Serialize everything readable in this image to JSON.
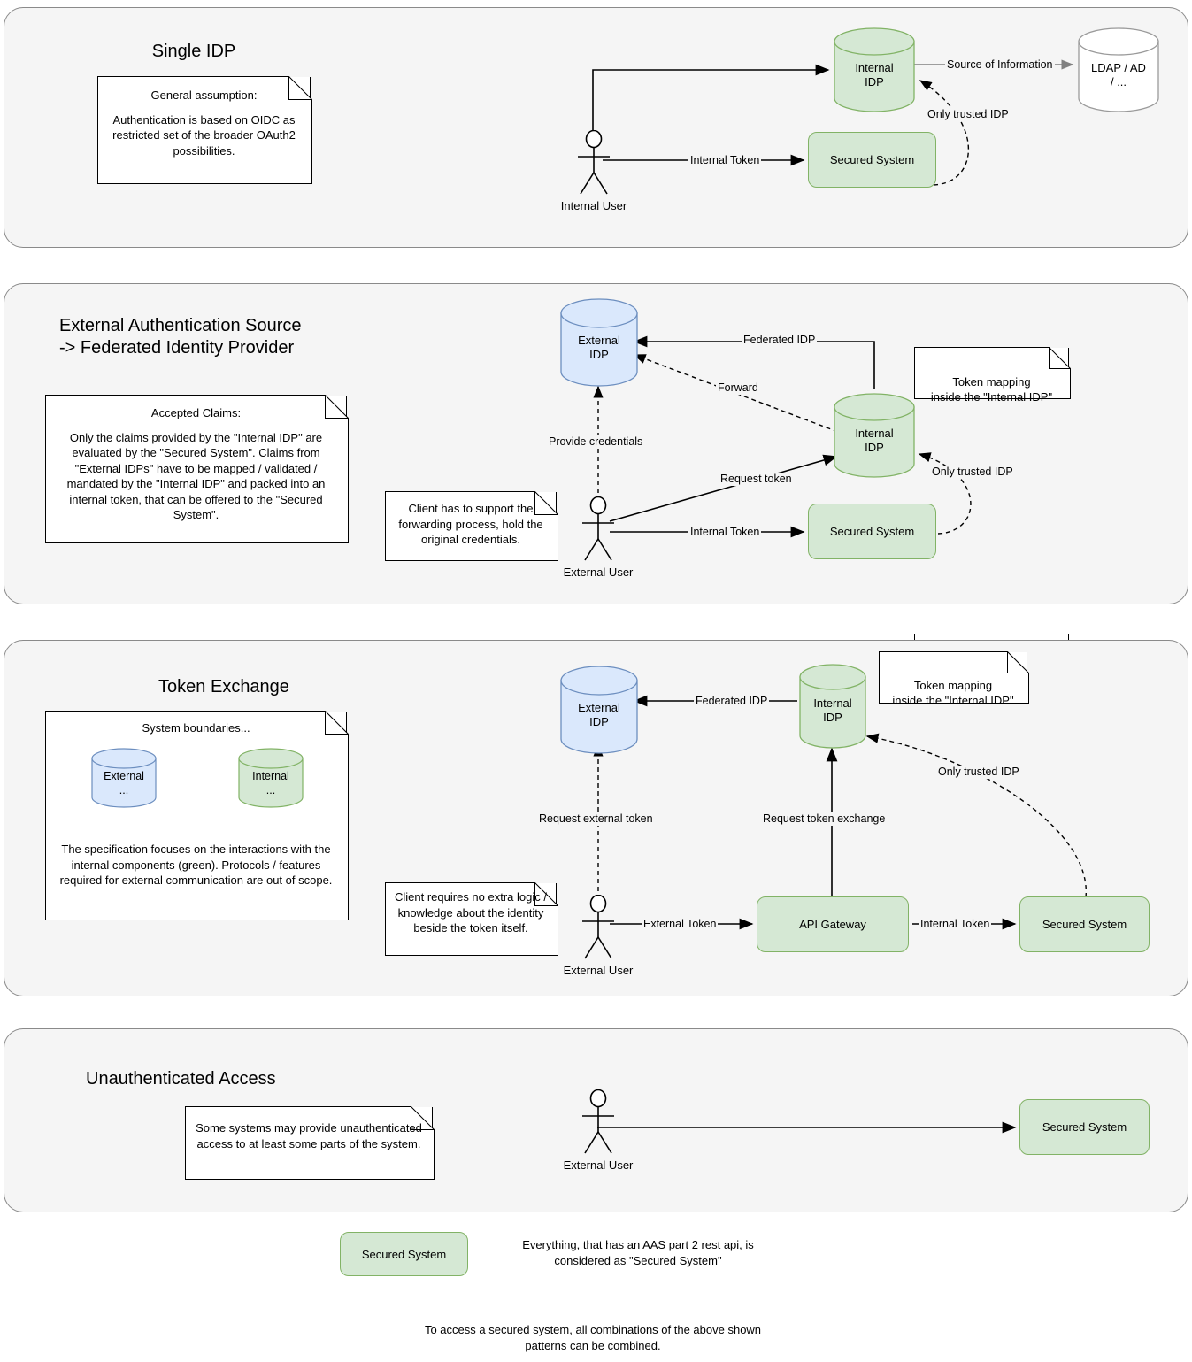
{
  "diagram": {
    "title_hidden": "",
    "colors": {
      "panel_bg": "#f5f5f5",
      "panel_border": "#8a8a8a",
      "green_fill": "#d5e8d4",
      "green_stroke": "#82b366",
      "blue_fill": "#dae8fc",
      "blue_stroke": "#6c8ebf",
      "white_fill": "#ffffff",
      "grey_stroke": "#9a9a9a",
      "line": "#000000"
    }
  },
  "panels": [
    {
      "id": "single-idp",
      "title": "Single IDP",
      "note": {
        "heading": "General assumption:",
        "body": "Authentication is based on OIDC as restricted set of the broader OAuth2 possibilities."
      },
      "nodes": {
        "actor": "Internal User",
        "internal_idp": "Internal\nIDP",
        "secured_system": "Secured System",
        "ldap": "LDAP / AD\n/ ..."
      },
      "edges": {
        "source_of_information": "Source of Information",
        "only_trusted_idp": "Only trusted IDP",
        "internal_token": "Internal Token"
      }
    },
    {
      "id": "external-auth-source",
      "title": "External Authentication Source\n-> Federated Identity Provider",
      "note_claims": {
        "heading": "Accepted Claims:",
        "body": "Only the claims provided by the \"Internal IDP\" are evaluated by the \"Secured System\". Claims from \"External IDPs\" have to be mapped / validated / mandated by the \"Internal IDP\" and packed into an internal token, that can be offered to the \"Secured System\"."
      },
      "note_client": "Client has to support the forwarding process, hold the original credentials.",
      "note_mapping": "Token mapping\ninside the \"Internal IDP\"",
      "nodes": {
        "actor": "External User",
        "external_idp": "External\nIDP",
        "internal_idp": "Internal\nIDP",
        "secured_system": "Secured System"
      },
      "edges": {
        "federated_idp": "Federated IDP",
        "forward": "Forward",
        "provide_credentials": "Provide credentials",
        "request_token": "Request token",
        "internal_token": "Internal Token",
        "only_trusted_idp": "Only trusted IDP"
      }
    },
    {
      "id": "token-exchange",
      "title": "Token Exchange",
      "note_boundaries": {
        "heading": "System boundaries...",
        "external_label": "External\n...",
        "internal_label": "Internal\n...",
        "body": "The specification focuses on the interactions with the internal components (green). Protocols / features required for external communication are out of scope."
      },
      "note_client": "Client requires no extra logic / knowledge about the identity beside the token itself.",
      "note_mapping": "Token mapping\ninside the \"Internal IDP\"",
      "nodes": {
        "actor": "External User",
        "external_idp": "External\nIDP",
        "internal_idp": "Internal\nIDP",
        "api_gateway": "API Gateway",
        "secured_system": "Secured System"
      },
      "edges": {
        "federated_idp": "Federated IDP",
        "request_external_token": "Request external token",
        "request_token_exchange": "Request token exchange",
        "external_token": "External Token",
        "internal_token": "Internal Token",
        "only_trusted_idp": "Only trusted IDP"
      }
    },
    {
      "id": "unauthenticated-access",
      "title": "Unauthenticated Access",
      "note": "Some systems may provide unauthenticated access to at least some parts of the system.",
      "nodes": {
        "actor": "External User",
        "secured_system": "Secured System"
      }
    }
  ],
  "legend": {
    "box_label": "Secured System",
    "description": "Everything, that has an AAS part 2 rest api, is\nconsidered as \"Secured System\""
  },
  "footer": {
    "text": "To access a secured system, all combinations of the above shown\npatterns can be combined."
  }
}
